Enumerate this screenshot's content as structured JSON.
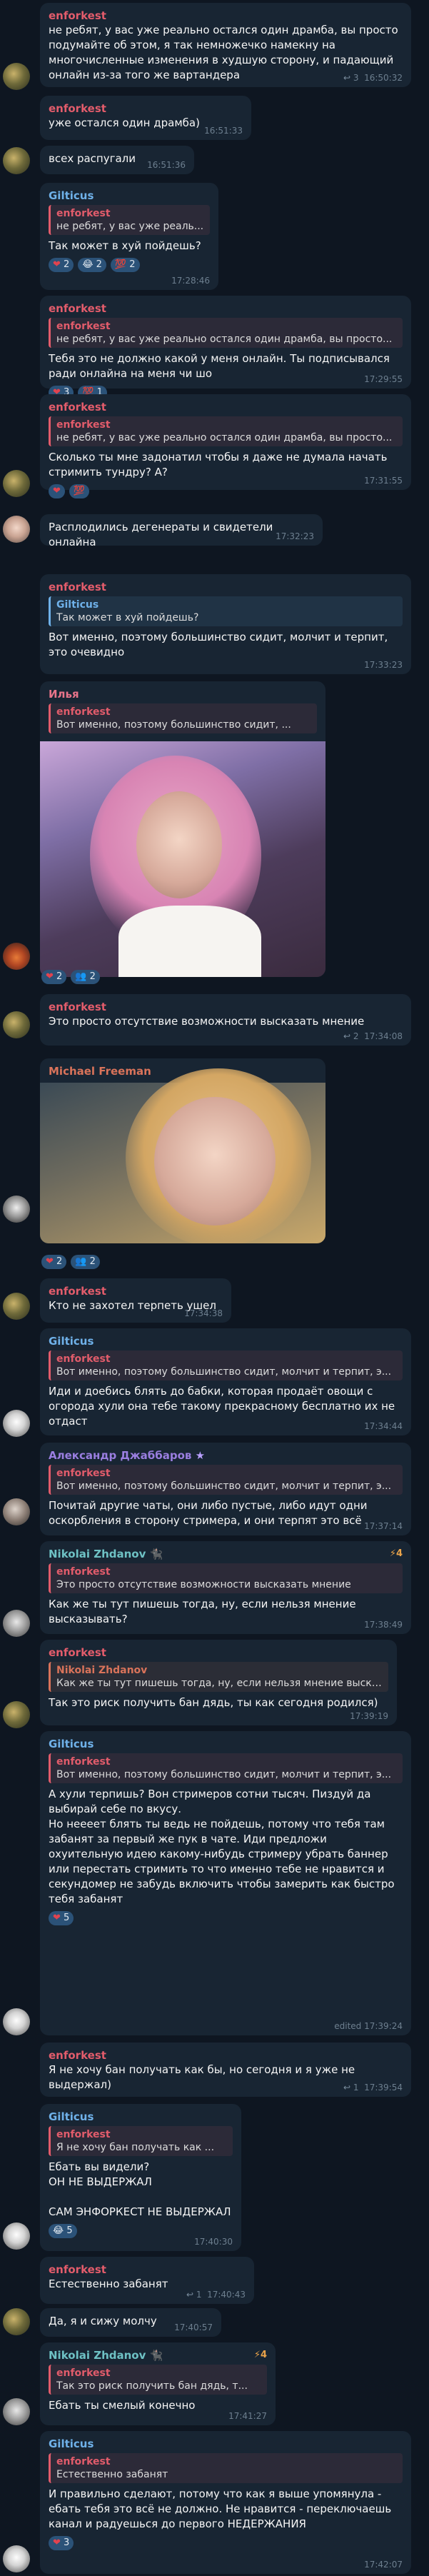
{
  "messages": [
    {
      "name": "enforkest",
      "text": "не ребят, у вас уже реально остался один драмба, вы просто подумайте об этом, я так немножечко намекну на многочисленные изменения в худшую сторону, и падающий онлайн из-за того же вартандера",
      "time": "16:50:32",
      "views": "3"
    },
    {
      "name": "enforkest",
      "text": "уже остался один драмба)",
      "time": "16:51:33"
    },
    {
      "text": "всех распугали",
      "time": "16:51:36"
    },
    {
      "name": "Gilticus",
      "reply_name": "enforkest",
      "reply_text": "не ребят, у вас уже реаль...",
      "text": "Так может в хуй пойдешь?",
      "time": "17:28:46",
      "reactions": [
        "❤ 2",
        "😂 2",
        "💯 2"
      ]
    },
    {
      "name": "enforkest",
      "reply_name": "enforkest",
      "reply_text": "не ребят, у вас уже реально остался один драмба, вы просто...",
      "text": "Тебя это не должно какой у меня онлайн. Ты подписывался ради онлайна на меня чи шо",
      "time": "17:29:55",
      "reactions": [
        "❤ 3",
        "💯 1"
      ]
    },
    {
      "name": "enforkest",
      "reply_name": "enforkest",
      "reply_text": "не ребят, у вас уже реально остался один драмба, вы просто...",
      "text": "Сколько ты мне задонатил чтобы я даже не думала начать стримить тундру? А?",
      "time": "17:31:55",
      "reactions": [
        "❤",
        "💯"
      ]
    },
    {
      "text": "Расплодились дегенераты и свидетели онлайна",
      "time": "17:32:23"
    },
    {
      "name": "enforkest",
      "reply_name": "Gilticus",
      "reply_text": "Так может в хуй пойдешь?",
      "text": "Вот именно, поэтому большинство сидит, молчит и терпит, это очевидно",
      "time": "17:33:23"
    },
    {
      "name": "Илья",
      "reply_name": "enforkest",
      "reply_text": "Вот именно, поэтому большинство сидит, ...",
      "reactions": [
        "❤ 2",
        "2"
      ]
    },
    {
      "name": "enforkest",
      "text": "Это просто отсутствие возможности высказать мнение",
      "time": "17:34:08",
      "views": "2"
    },
    {
      "name": "Michael Freeman",
      "reactions": [
        "❤ 2",
        "2"
      ]
    },
    {
      "name": "enforkest",
      "text": "Кто не захотел терпеть ушел",
      "time": "17:34:38"
    },
    {
      "name": "Gilticus",
      "reply_name": "enforkest",
      "reply_text": "Вот именно, поэтому большинство сидит, молчит и терпит, э...",
      "text": "Иди и доебись блять до бабки, которая продаёт овощи с огорода хули она тебе такому прекрасному бесплатно их не отдаст",
      "time": "17:34:44"
    },
    {
      "name": "Александр Джаббаров",
      "reply_name": "enforkest",
      "reply_text": "Вот именно, поэтому большинство сидит, молчит и терпит, э...",
      "text": "Почитай другие чаты, они либо пустые, либо идут одни оскорбления в сторону стримера, и они терпят это всё",
      "time": "17:37:14"
    },
    {
      "name": "Nikolai Zhdanov",
      "reply_name": "enforkest",
      "reply_text": "Это просто отсутствие возможности высказать мнение",
      "text": "Как же ты тут пишешь тогда, ну, если нельзя мнение высказывать?",
      "time": "17:38:49",
      "badge": "4"
    },
    {
      "name": "enforkest",
      "reply_name": "Nikolai Zhdanov",
      "reply_text": "Как же ты тут пишешь тогда, ну, если нельзя мнение высказ...",
      "text": "Так это риск получить бан дядь, ты как сегодня родился)",
      "time": "17:39:19"
    },
    {
      "name": "Gilticus",
      "reply_name": "enforkest",
      "reply_text": "Вот именно, поэтому большинство сидит, молчит и терпит, э...",
      "text": "А хули терпишь? Вон стримеров сотни тысяч. Пиздуй да выбирай себе по вкусу.\nНо неееет блять ты ведь не пойдешь, потому что тебя там забанят за первый же пук в чате. Иди предложи охуительную идею какому-нибудь стримеру убрать баннер или перестать стримить то что именно тебе не нравится и секундомер не забудь включить чтобы замерить как быстро тебя забанят",
      "time": "edited 17:39:24"
    },
    {
      "name": "enforkest",
      "text": "Я не хочу бан получать как бы, но сегодня и я уже не выдержал)",
      "time": "17:39:54",
      "views": "1"
    },
    {
      "name": "Gilticus",
      "reply_name": "enforkest",
      "reply_text": "Я не хочу бан получать как ...",
      "text": "Ебать вы видели?\nОН НЕ ВЫДЕРЖАЛ\n\nСАМ ЭНФОРКЕСТ НЕ ВЫДЕРЖАЛ",
      "time": "17:40:30",
      "reactions": [
        "5"
      ]
    },
    {
      "name": "enforkest",
      "text": "Естественно забанят",
      "time": "17:40:43",
      "views": "1"
    },
    {
      "text": "Да, я и сижу молчу",
      "time": "17:40:57"
    },
    {
      "name": "Nikolai Zhdanov",
      "reply_name": "enforkest",
      "reply_text": "Так это риск получить бан дядь, т...",
      "text": "Ебать ты смелый конечно",
      "time": "17:41:27",
      "badge": "4"
    },
    {
      "name": "Gilticus",
      "reply_name": "enforkest",
      "reply_text": "Естественно забанят",
      "text": "И правильно сделают, потому что как я выше упомянула - ебать тебя это всё не должно. Не нравится - переключаешь канал и радуешься до первого НЕДЕРЖАНИЯ",
      "time": "17:42:07",
      "reactions": [
        "❤ 3"
      ]
    }
  ]
}
